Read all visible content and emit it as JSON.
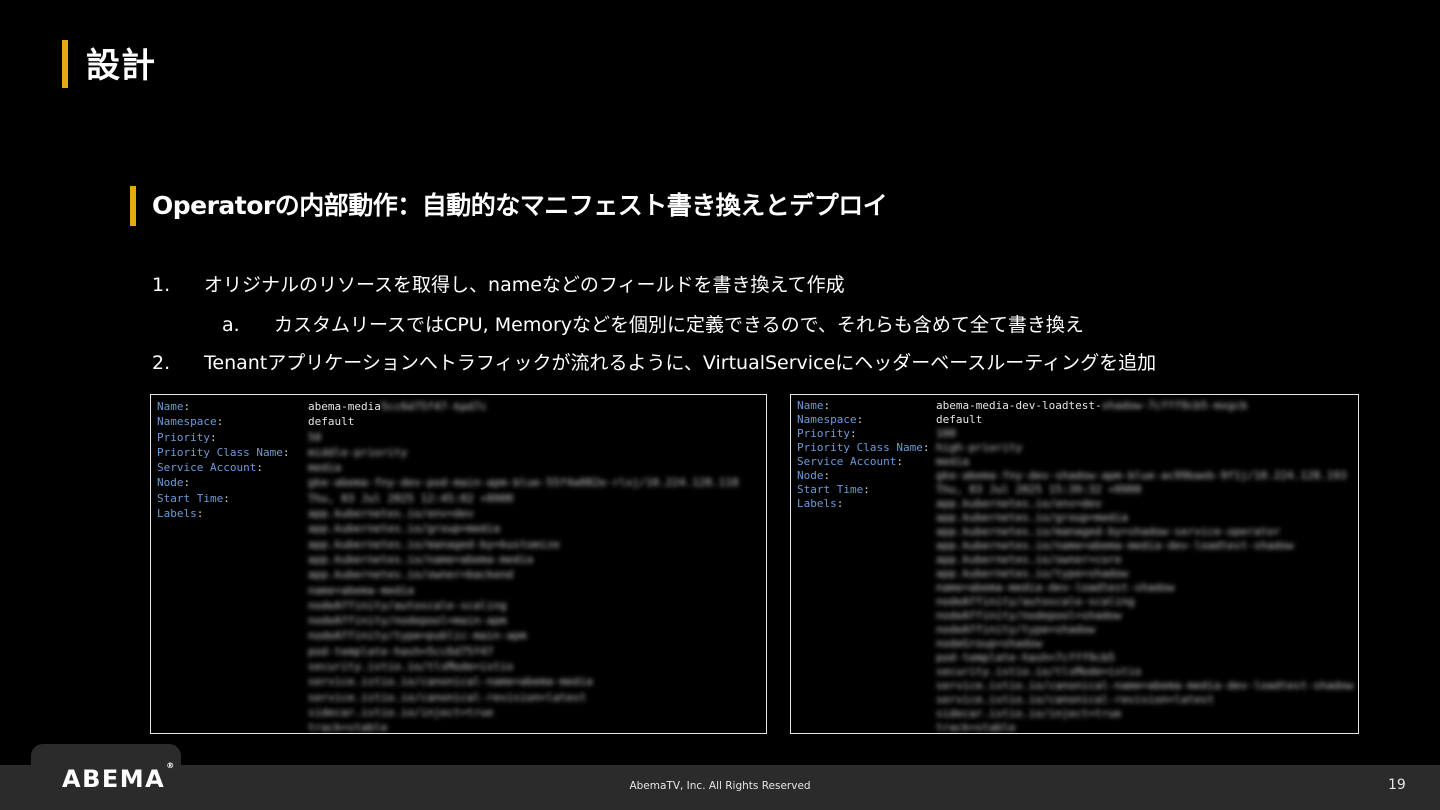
{
  "colors": {
    "accent": "#e8a812",
    "key_blue": "#6b9bd8",
    "background": "#000000",
    "footer": "#2b2b2b"
  },
  "slide": {
    "title": "設計",
    "subtitle": "Operatorの内部動作：自動的なマニフェスト書き換えとデプロイ",
    "list": [
      {
        "num": "1.",
        "text": "オリジナルのリソースを取得し、nameなどのフィールドを書き換えて作成"
      },
      {
        "num": "a.",
        "text": "カスタムリースではCPU, Memoryなどを個別に定義できるので、それらも含めて全て書き換え"
      },
      {
        "num": "2.",
        "text": "Tenantアプリケーションへトラフィックが流れるように、VirtualServiceにヘッダーベースルーティングを追加"
      }
    ]
  },
  "terminals": {
    "left": {
      "keys": [
        "Name",
        "Namespace",
        "Priority",
        "Priority Class Name",
        "Service Account",
        "Node",
        "Start Time",
        "Labels"
      ],
      "name_value": "abema-media",
      "name_blurred": "5cc6d75f47-kpd7c",
      "namespace_value": "default",
      "blurred_values": [
        "50",
        "middle-priority",
        "media",
        "gke-abema-fny-dev-pod-main-apm-blue-55f4a082e-rlxj/10.224.128.118",
        "Thu, 03 Jul 2025 12:45:02 +0900",
        "app.kubernetes.io/env=dev",
        "app.kubernetes.io/group=media",
        "app.kubernetes.io/managed-by=kustomize",
        "app.kubernetes.io/name=abema-media",
        "app.kubernetes.io/owner=backend",
        "name=abema-media",
        "nodeAffinity/autoscale-scaling",
        "nodeAffinity/nodepool=main-apm",
        "nodeAffinity/type=public-main-apm",
        "pod-template-hash=5cc6d75f47",
        "security.istio.io/tlsMode=istio",
        "service.istio.io/canonical-name=abema-media",
        "service.istio.io/canonical-revision=latest",
        "sidecar.istio.io/inject=true",
        "track=stable"
      ]
    },
    "right": {
      "keys": [
        "Name",
        "Namespace",
        "Priority",
        "Priority Class Name",
        "Service Account",
        "Node",
        "Start Time",
        "Labels"
      ],
      "name_value": "abema-media-dev-loadtest-",
      "name_blurred": "shadow-7cfff9cb5-mxgcb",
      "namespace_value": "default",
      "blurred_values": [
        "100",
        "high-priority",
        "media",
        "gke-abema-fny-dev-shadow-apm-blue-ac99baeb-9f1j/10.224.128.193",
        "Thu, 03 Jul 2025 15:39:32 +0900",
        "app.kubernetes.io/env=dev",
        "app.kubernetes.io/group=media",
        "app.kubernetes.io/managed-by=shadow-service-operator",
        "app.kubernetes.io/name=abema-media-dev-loadtest-shadow",
        "app.kubernetes.io/owner=core",
        "app.kubernetes.io/type=shadow",
        "name=abema-media-dev-loadtest-shadow",
        "nodeAffinity/autoscale-scaling",
        "nodeAffinity/nodepool=shadow",
        "nodeAffinity/type=shadow",
        "nodeGroup=shadow",
        "pod-template-hash=7cfff9cb5",
        "security.istio.io/tlsMode=istio",
        "service.istio.io/canonical-name=abema-media-dev-loadtest-shadow",
        "service.istio.io/canonical-revision=latest",
        "sidecar.istio.io/inject=true",
        "track=stable"
      ]
    }
  },
  "footer": {
    "logo": "ABEMA",
    "logo_mark": "®",
    "copyright": "AbemaTV, Inc. All Rights Reserved",
    "page_number": "19"
  }
}
